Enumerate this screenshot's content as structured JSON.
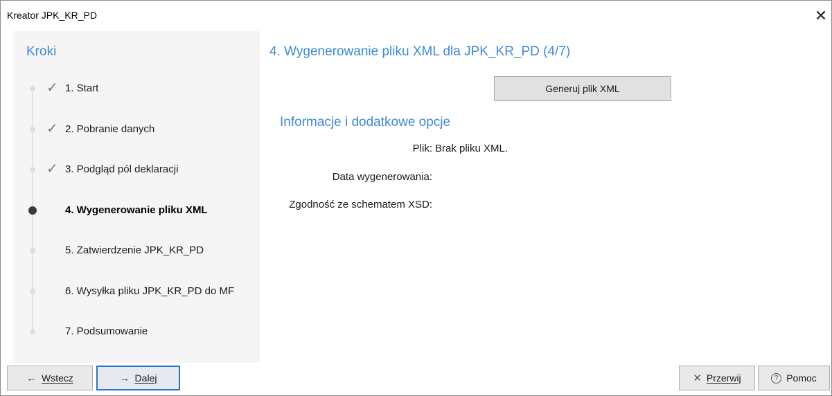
{
  "window": {
    "title": "Kreator JPK_KR_PD",
    "close_glyph": "✕"
  },
  "sidebar": {
    "title": "Kroki",
    "steps": [
      {
        "label": "1. Start",
        "status": "done"
      },
      {
        "label": "2. Pobranie danych",
        "status": "done"
      },
      {
        "label": "3. Podgląd pól deklaracji",
        "status": "done"
      },
      {
        "label": "4. Wygenerowanie pliku XML",
        "status": "current"
      },
      {
        "label": "5. Zatwierdzenie JPK_KR_PD",
        "status": "pending"
      },
      {
        "label": "6. Wysyłka pliku JPK_KR_PD do MF",
        "status": "pending"
      },
      {
        "label": "7. Podsumowanie",
        "status": "pending"
      }
    ],
    "check_glyph": "✓"
  },
  "main": {
    "title": "4. Wygenerowanie pliku XML dla JPK_KR_PD (4/7)",
    "generate_button": "Generuj plik XML",
    "section_title": "Informacje i dodatkowe opcje",
    "info": {
      "file_label": "Plik:",
      "file_value": "Brak pliku XML.",
      "date_label": "Data wygenerowania:",
      "xsd_label": "Zgodność ze schematem XSD:"
    }
  },
  "footer": {
    "back": {
      "icon": "←",
      "label": "Wstecz"
    },
    "next": {
      "icon": "→",
      "label": "Dalej"
    },
    "abort": {
      "icon": "✕",
      "label": "Przerwij"
    },
    "help": {
      "icon": "?",
      "label": "Pomoc"
    }
  },
  "colors": {
    "accent": "#3d8ad8",
    "sidebar_bg": "#f5f5f5",
    "primary_border": "#2a74c9"
  }
}
